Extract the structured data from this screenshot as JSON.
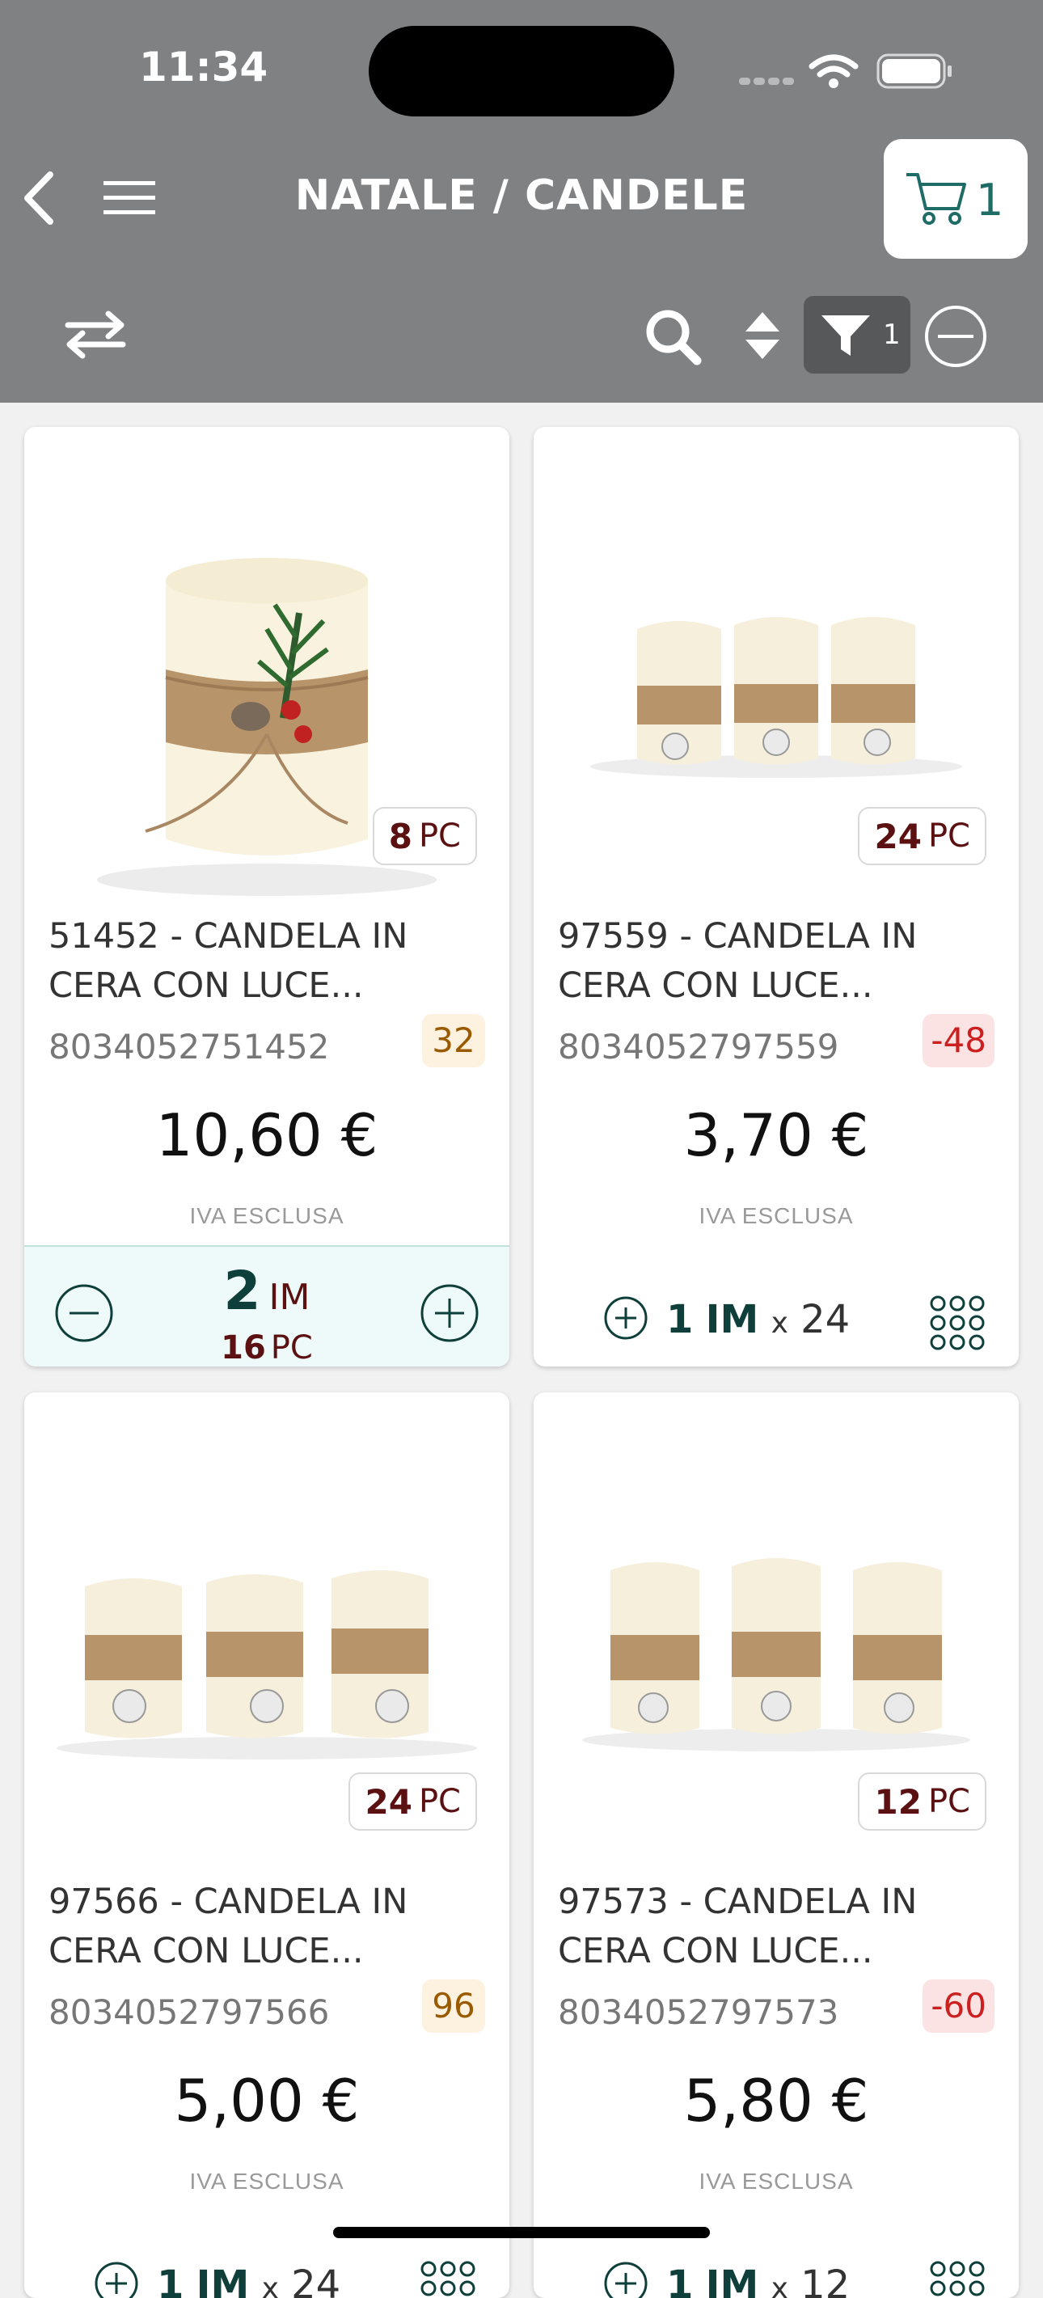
{
  "status_bar": {
    "time": "11:34"
  },
  "header": {
    "title": "NATALE / CANDELE",
    "cart_count": "1"
  },
  "toolbar": {
    "filter_count": "1"
  },
  "products": [
    {
      "pc_count": "8",
      "pc_unit": "PC",
      "title": "51452 - CANDELA IN\nCERA CON LUCE...",
      "ean": "8034052751452",
      "stock": "32",
      "price": "10,60 €",
      "iva_label": "IVA ESCLUSA",
      "cart_qty": "2",
      "cart_unit": "IM",
      "cart_pcs": "16",
      "cart_pcs_unit": "PC"
    },
    {
      "pc_count": "24",
      "pc_unit": "PC",
      "title": "97559 - CANDELA IN\nCERA CON LUCE...",
      "ean": "8034052797559",
      "stock": "-48",
      "price": "3,70 €",
      "iva_label": "IVA ESCLUSA",
      "add_qty": "1",
      "add_unit": "IM",
      "add_x": "x",
      "add_mult": "24"
    },
    {
      "pc_count": "24",
      "pc_unit": "PC",
      "title": "97566 - CANDELA IN\nCERA CON LUCE...",
      "ean": "8034052797566",
      "stock": "96",
      "price": "5,00 €",
      "iva_label": "IVA ESCLUSA",
      "add_qty": "1",
      "add_unit": "IM",
      "add_x": "x",
      "add_mult": "24"
    },
    {
      "pc_count": "12",
      "pc_unit": "PC",
      "title": "97573 - CANDELA IN\nCERA CON LUCE...",
      "ean": "8034052797573",
      "stock": "-60",
      "price": "5,80 €",
      "iva_label": "IVA ESCLUSA",
      "add_qty": "1",
      "add_unit": "IM",
      "add_x": "x",
      "add_mult": "12"
    }
  ],
  "icons": {
    "back": "chevron-left-icon",
    "menu": "hamburger-icon",
    "cart": "cart-icon",
    "swap": "swap-arrows-icon",
    "search": "search-icon",
    "sort": "sort-icon",
    "filter": "filter-icon",
    "collapse": "minus-circle-icon",
    "grid": "grid-dots-icon"
  },
  "colors": {
    "header_bg": "#808183",
    "accent_teal": "#0e3f3a",
    "brand_maroon": "#5b1111",
    "stock_positive": "#9a5b00",
    "stock_negative": "#cc1f1f"
  }
}
